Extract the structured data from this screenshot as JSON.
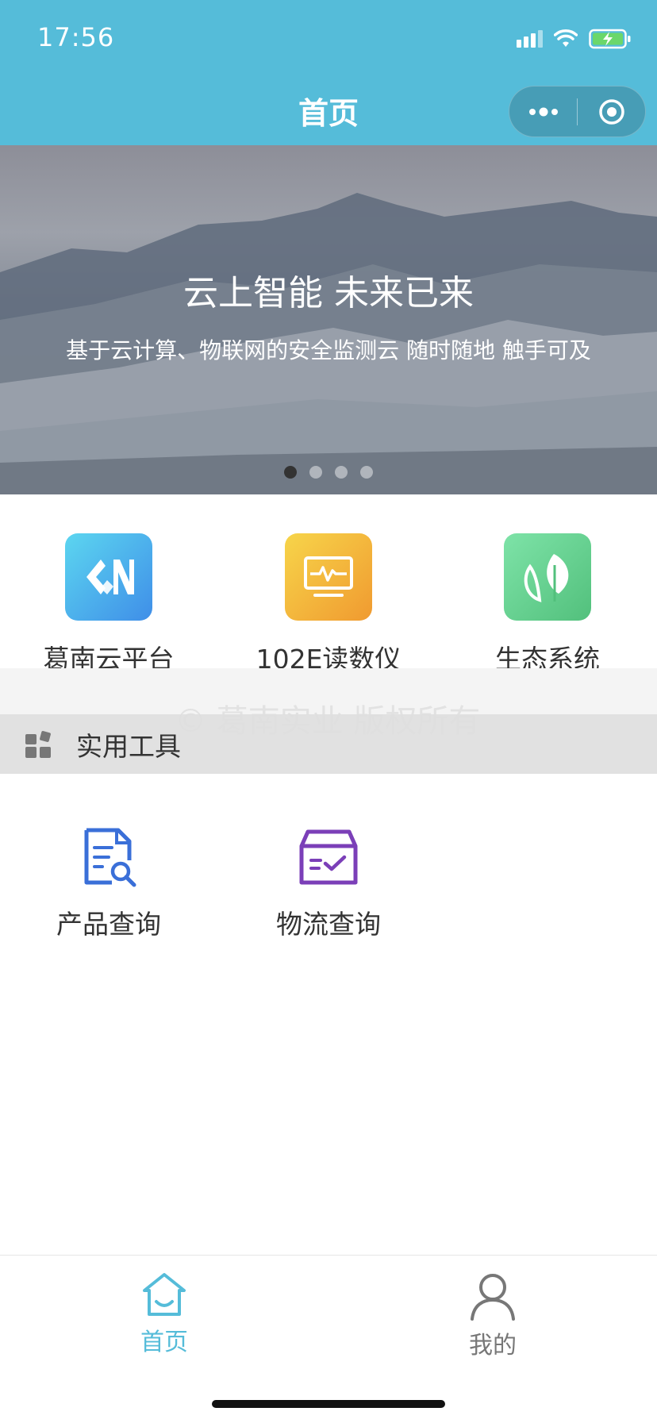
{
  "status_bar": {
    "time": "17:56"
  },
  "nav": {
    "title": "首页"
  },
  "banner": {
    "title": "云上智能 未来已来",
    "subtitle": "基于云计算、物联网的安全监测云 随时随地 触手可及",
    "slide_count": 4,
    "active_slide": 1
  },
  "apps": [
    {
      "label": "葛南云平台",
      "icon": "gn-logo-icon",
      "color": "#4aa8ee"
    },
    {
      "label": "102E读数仪",
      "icon": "monitor-pulse-icon",
      "color": "#f2a535"
    },
    {
      "label": "生态系统",
      "icon": "leaf-icon",
      "color": "#62cf8e"
    }
  ],
  "watermark": {
    "text": "©   葛南实业 版权所有"
  },
  "section": {
    "title": "实用工具",
    "icon": "widgets-icon"
  },
  "tools": [
    {
      "label": "产品查询",
      "icon": "document-search-icon",
      "color": "#3a6fd8"
    },
    {
      "label": "物流查询",
      "icon": "box-check-icon",
      "color": "#7b3fb8"
    }
  ],
  "tabbar": {
    "items": [
      {
        "label": "首页",
        "icon": "home-icon",
        "active": true,
        "color": "#55bcd9"
      },
      {
        "label": "我的",
        "icon": "user-icon",
        "active": false,
        "color": "#777777"
      }
    ]
  }
}
